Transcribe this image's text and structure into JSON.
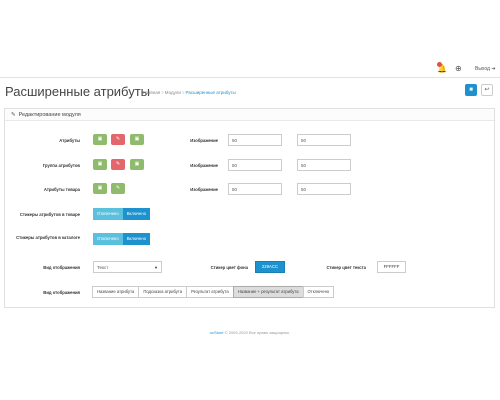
{
  "topbar": {
    "bell_icon": "bell-icon",
    "badge_count": "",
    "help_icon": "lifebuoy-icon",
    "logout_label": "Выход"
  },
  "header": {
    "title": "Расширенные атрибуты",
    "breadcrumb": [
      "Главная",
      "Модули",
      "Расширенные атрибуты"
    ],
    "save_icon": "save-icon",
    "back_icon": "reply-icon"
  },
  "panel": {
    "title": "Редактирование модуля",
    "rows": [
      {
        "label": "Атрибуты",
        "buttons": [
          "green",
          "red",
          "green"
        ],
        "field_label": "Изображение",
        "width": "50",
        "height": "50"
      },
      {
        "label": "Группа атрибутов",
        "buttons": [
          "green",
          "red",
          "green"
        ],
        "field_label": "Изображение",
        "width": "50",
        "height": "50"
      },
      {
        "label": "Атрибуты товара",
        "buttons": [
          "green",
          "green"
        ],
        "field_label": "Изображение",
        "width": "50",
        "height": "50"
      }
    ],
    "sticker_product": {
      "label": "Стикеры атрибутов в товаре",
      "off": "Отключено",
      "on": "Включено"
    },
    "sticker_catalog": {
      "label": "Стикеры атрибутов в каталоге",
      "off": "Отключено",
      "on": "Включено"
    },
    "view_display": {
      "label": "Вид отображения",
      "select_value": "Текст"
    },
    "sticker_bg": {
      "label": "Стикер цвет фона",
      "value": "229ACC"
    },
    "sticker_text": {
      "label": "Стикер цвет текста",
      "value": "FFFFFF"
    },
    "view_display2": {
      "label": "Вид отображения",
      "options": [
        "Название атрибута",
        "Подсказка атрибута",
        "Результат атрибута",
        "Название + результат атрибута",
        "Отключено"
      ],
      "active_index": 3
    }
  },
  "footer": {
    "link": "ocStore",
    "text": " © 2009-2020 Все права защищены."
  },
  "colors": {
    "accent": "#1e91cf",
    "green": "#8fbb6c",
    "red": "#e3676a",
    "toggle_off": "#5bc0de"
  }
}
